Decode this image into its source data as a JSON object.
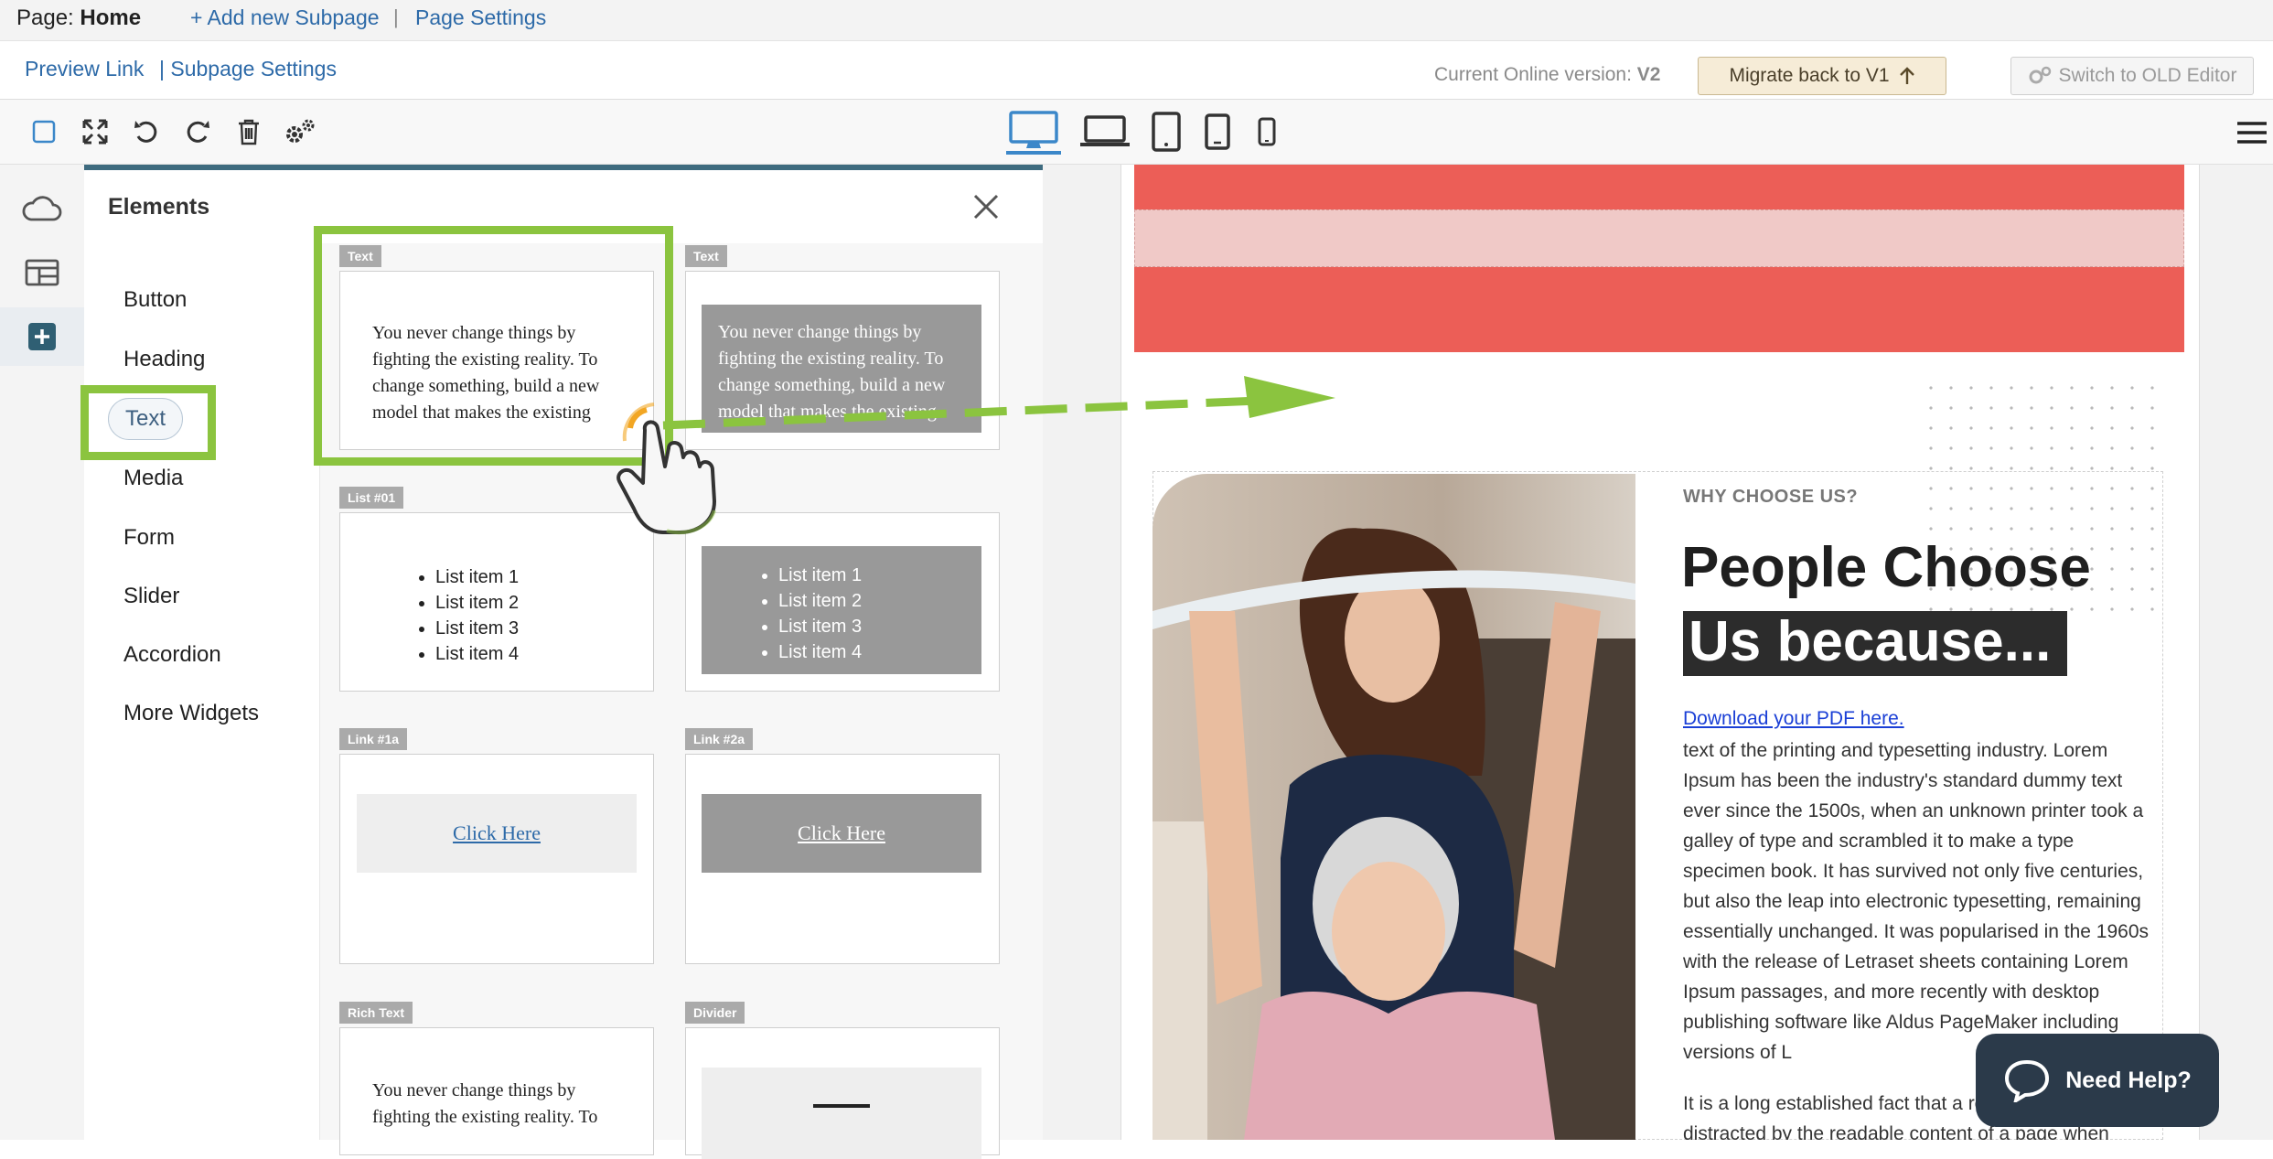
{
  "topbar": {
    "page_prefix": "Page:",
    "page_name": "Home",
    "add_subpage": "+ Add new Subpage",
    "separator": "|",
    "page_settings": "Page Settings"
  },
  "bar2": {
    "preview_link": "Preview Link",
    "subpage_settings": "| Subpage Settings",
    "version_label": "Current Online version:",
    "version_value": "V2",
    "migrate_label": "Migrate back to V1",
    "switch_label": "Switch to OLD Editor"
  },
  "toolbar": {
    "icons": [
      "select-icon",
      "fullscreen-icon",
      "undo-icon",
      "redo-icon",
      "trash-icon",
      "gears-icon"
    ],
    "devices": [
      "desktop-icon",
      "laptop-icon",
      "tablet-icon",
      "tablet-small-icon",
      "phone-icon"
    ]
  },
  "rail": {
    "icons": [
      "cloud-icon",
      "layout-icon",
      "add-icon"
    ]
  },
  "panel": {
    "title": "Elements",
    "categories": [
      "Button",
      "Heading",
      "Text",
      "Media",
      "Form",
      "Slider",
      "Accordion",
      "More Widgets"
    ]
  },
  "cards": {
    "text1": {
      "tag": "Text",
      "body": "You never change things by fighting the existing reality. To change something, build a new model that makes the existing"
    },
    "text2": {
      "tag": "Text",
      "body": "You never change things by fighting the existing reality. To change something, build a new model that makes the existing"
    },
    "list1": {
      "tag": "List #01",
      "items": [
        "List item 1",
        "List item 2",
        "List item 3",
        "List item 4"
      ]
    },
    "list2": {
      "items": [
        "List item 1",
        "List item 2",
        "List item 3",
        "List item 4"
      ]
    },
    "link1": {
      "tag": "Link #1a",
      "label": "Click Here"
    },
    "link2": {
      "tag": "Link #2a",
      "label": "Click Here"
    },
    "rich": {
      "tag": "Rich Text",
      "body": "You never change things by fighting the existing reality. To"
    },
    "divider": {
      "tag": "Divider"
    }
  },
  "canvas": {
    "eyebrow": "WHY CHOOSE US?",
    "heading_line1": "People Choose",
    "heading_line2": "Us because...",
    "pdf_link": "Download your PDF here.",
    "paragraph": "text of the printing and typesetting industry. Lorem Ipsum has been the industry's standard dummy text ever since the 1500s, when an unknown printer took a galley of type and scrambled it to make a type specimen book. It has survived not only five centuries, but also the leap into electronic typesetting, remaining essentially unchanged. It was popularised in the 1960s with the release of Letraset sheets containing Lorem Ipsum passages, and more recently with desktop publishing software like Aldus PageMaker including versions of L",
    "paragraph2": "It is a long established fact that a reader will be distracted by the readable content of a page when"
  },
  "help": {
    "label": "Need Help?"
  },
  "colors": {
    "accent_green": "#8bc43f",
    "brand_red": "#ec5e57",
    "panel_top": "#3e6b7f",
    "link_blue": "#2d6aa8"
  }
}
